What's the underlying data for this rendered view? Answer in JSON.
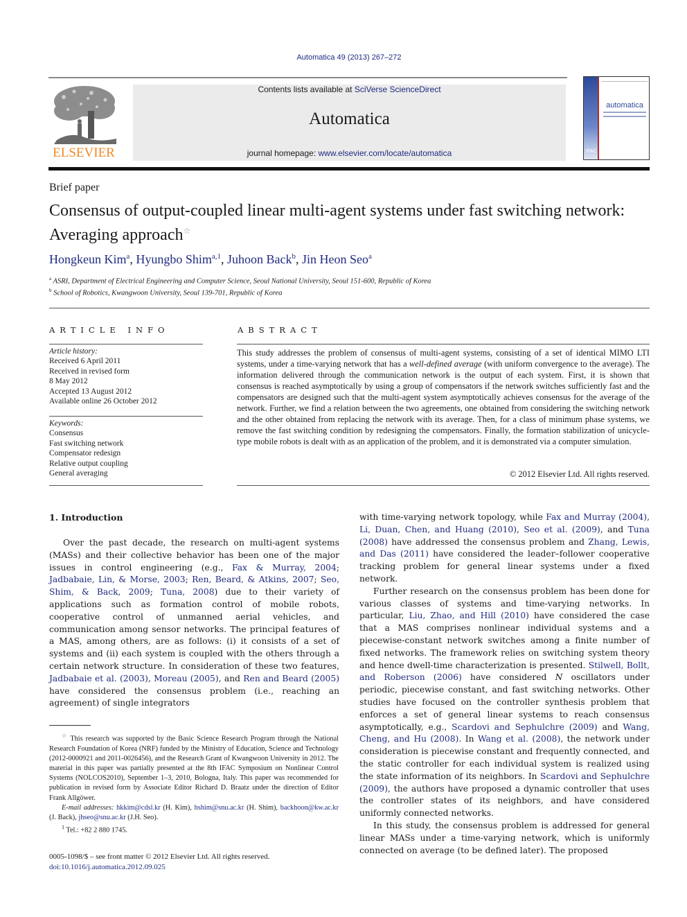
{
  "header": {
    "citation": "Automatica 49 (2013) 267–272",
    "contents_prefix": "Contents lists available at ",
    "contents_link": "SciVerse ScienceDirect",
    "journal_name": "Automatica",
    "homepage_prefix": "journal homepage: ",
    "homepage_link": "www.elsevier.com/locate/automatica",
    "publisher_logo_text": "ELSEVIER",
    "cover_title": "automatica",
    "cover_ifac": "IFAC",
    "colors": {
      "link": "#1f2a80",
      "publisher_orange": "#f08a24",
      "masthead_bg": "#ebebeb"
    }
  },
  "article": {
    "type": "Brief paper",
    "title": "Consensus of output-coupled linear multi-agent systems under fast switching network: Averaging approach",
    "title_mark": "☆",
    "authors": [
      {
        "name": "Hongkeun Kim",
        "aff": "a"
      },
      {
        "name": "Hyungbo Shim",
        "aff": "a,1"
      },
      {
        "name": "Juhoon Back",
        "aff": "b"
      },
      {
        "name": "Jin Heon Seo",
        "aff": "a"
      }
    ],
    "affiliations": [
      {
        "key": "a",
        "text": "ASRI, Department of Electrical Engineering and Computer Science, Seoul National University, Seoul 151-600, Republic of Korea"
      },
      {
        "key": "b",
        "text": "School of Robotics, Kwangwoon University, Seoul 139-701, Republic of Korea"
      }
    ]
  },
  "article_info": {
    "heading": "ARTICLE INFO",
    "history_label": "Article history:",
    "history": [
      "Received 6 April 2011",
      "Received in revised form",
      "8 May 2012",
      "Accepted 13 August 2012",
      "Available online 26 October 2012"
    ],
    "keywords_label": "Keywords:",
    "keywords": [
      "Consensus",
      "Fast switching network",
      "Compensator redesign",
      "Relative output coupling",
      "General averaging"
    ]
  },
  "abstract": {
    "heading": "ABSTRACT",
    "text_1": "This study addresses the problem of consensus of multi-agent systems, consisting of a set of identical MIMO LTI systems, under a time-varying network that has a ",
    "text_em": "well-defined average",
    "text_2": " (with uniform convergence to the average). The information delivered through the communication network is the output of each system. First, it is shown that consensus is reached asymptotically by using a group of compensators if the network switches sufficiently fast and the compensators are designed such that the multi-agent system asymptotically achieves consensus for the average of the network. Further, we find a relation between the two agreements, one obtained from considering the switching network and the other obtained from replacing the network with its average. Then, for a class of minimum phase systems, we remove the fast switching condition by redesigning the compensators. Finally, the formation stabilization of unicycle-type mobile robots is dealt with as an application of the problem, and it is demonstrated via a computer simulation.",
    "copyright": "© 2012 Elsevier Ltd. All rights reserved."
  },
  "intro": {
    "heading": "1.  Introduction",
    "p1": [
      {
        "t": "Over the past decade, the research on multi-agent systems (MASs) and their collective behavior has been one of the major issues in control engineering (e.g., "
      },
      {
        "l": "Fax & Murray, 2004"
      },
      {
        "t": "; "
      },
      {
        "l": "Jadbabaie, Lin, & Morse, 2003"
      },
      {
        "t": "; "
      },
      {
        "l": "Ren, Beard, & Atkins, 2007"
      },
      {
        "t": "; "
      },
      {
        "l": "Seo, Shim, & Back, 2009"
      },
      {
        "t": "; "
      },
      {
        "l": "Tuna, 2008"
      },
      {
        "t": ") due to their variety of applications such as formation control of mobile robots, cooperative control of unmanned aerial vehicles, and communication among sensor networks. The principal features of a MAS, among others, are as follows: (i) it consists of a set of systems and (ii) each system is coupled with the others through a certain network structure. In consideration of these two features, "
      },
      {
        "l": "Jadbabaie et al. (2003)"
      },
      {
        "t": ", "
      },
      {
        "l": "Moreau (2005)"
      },
      {
        "t": ", and "
      },
      {
        "l": "Ren and Beard (2005)"
      },
      {
        "t": " have considered the consensus problem (i.e., reaching an agreement) of single integrators"
      }
    ],
    "p1_cont": [
      {
        "t": "with time-varying network topology, while "
      },
      {
        "l": "Fax and Murray (2004)"
      },
      {
        "t": ", "
      },
      {
        "l": "Li, Duan, Chen, and Huang (2010)"
      },
      {
        "t": ", "
      },
      {
        "l": "Seo et al. (2009)"
      },
      {
        "t": ", and "
      },
      {
        "l": "Tuna (2008)"
      },
      {
        "t": " have addressed the consensus problem and "
      },
      {
        "l": "Zhang, Lewis, and Das (2011)"
      },
      {
        "t": " have considered the leader–follower cooperative tracking problem for general linear systems under a fixed network."
      }
    ],
    "p2": [
      {
        "t": "Further research on the consensus problem has been done for various classes of systems and time-varying networks. In particular, "
      },
      {
        "l": "Liu, Zhao, and Hill (2010)"
      },
      {
        "t": " have considered the case that a MAS comprises nonlinear individual systems and a piecewise-constant network switches among a finite number of fixed networks. The framework relies on switching system theory and hence dwell-time characterization is presented. "
      },
      {
        "l": "Stilwell, Bollt, and Roberson (2006)"
      },
      {
        "t": " have considered "
      },
      {
        "i": "N"
      },
      {
        "t": " oscillators under periodic, piecewise constant, and fast switching networks. Other studies have focused on the controller synthesis problem that enforces a set of general linear systems to reach consensus asymptotically, e.g., "
      },
      {
        "l": "Scardovi and Sephulchre (2009)"
      },
      {
        "t": " and "
      },
      {
        "l": "Wang, Cheng, and Hu (2008)"
      },
      {
        "t": ". In "
      },
      {
        "l": "Wang et al. (2008)"
      },
      {
        "t": ", the network under consideration is piecewise constant and frequently connected, and the static controller for each individual system is realized using the state information of its neighbors. In "
      },
      {
        "l": "Scardovi and Sephulchre (2009)"
      },
      {
        "t": ", the authors have proposed a dynamic controller that uses the controller states of its neighbors, and have considered uniformly connected networks."
      }
    ],
    "p3": [
      {
        "t": "In this study, the consensus problem is addressed for general linear MASs under a time-varying network, which is uniformly connected on average (to be defined later). The proposed"
      }
    ]
  },
  "footnotes": {
    "star_mark": "☆",
    "funding": "This research was supported by the Basic Science Research Program through the National Research Foundation of Korea (NRF) funded by the Ministry of Education, Science and Technology (2012-0000921 and 2011-0026456), and the Research Grant of Kwangwoon University in 2012. The material in this paper was partially presented at the 8th IFAC Symposium on Nonlinear Control Systems (NOLCOS2010), September 1–3, 2010, Bologna, Italy. This paper was recommended for publication in revised form by Associate Editor Richard D. Braatz under the direction of Editor Frank Allgöwer.",
    "email_label": "E-mail addresses:",
    "emails": [
      {
        "addr": "hkkim@cdsl.kr",
        "who": " (H. Kim), "
      },
      {
        "addr": "hshim@snu.ac.kr",
        "who": " (H. Shim), "
      },
      {
        "addr": "backhoon@kw.ac.kr",
        "who": " (J. Back), "
      },
      {
        "addr": "jhseo@snu.ac.kr",
        "who": " (J.H. Seo)."
      }
    ],
    "tel_mark": "1",
    "tel": "Tel.: +82 2 880 1745."
  },
  "bottom": {
    "issn": "0005-1098/$ – see front matter © 2012 Elsevier Ltd. All rights reserved.",
    "doi": "doi:10.1016/j.automatica.2012.09.025"
  }
}
